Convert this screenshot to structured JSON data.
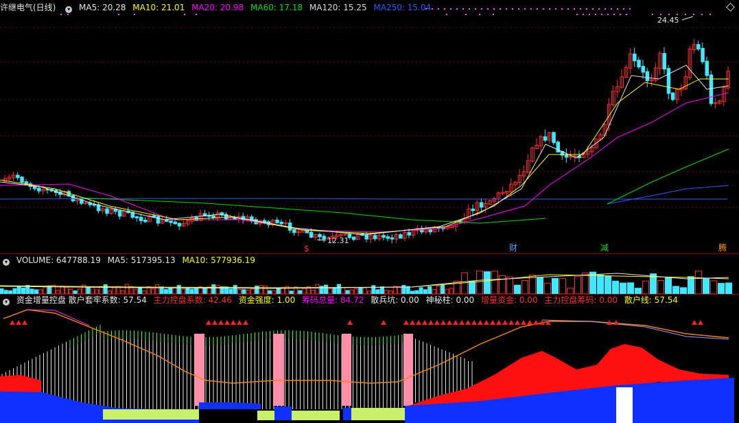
{
  "main": {
    "stock": "许继电气(日线)",
    "ma": [
      {
        "label": "MA5: 20.28",
        "color": "#e6e6e6"
      },
      {
        "label": "MA10: 21.01",
        "color": "#ffff00"
      },
      {
        "label": "MA20: 20.98",
        "color": "#ff00ff"
      },
      {
        "label": "MA60: 17.18",
        "color": "#00e000"
      },
      {
        "label": "MA120: 15.25",
        "color": "#dcdcdc"
      },
      {
        "label": "MA250: 15.04",
        "color": "#2a5cff"
      }
    ],
    "high_label": "24.45",
    "low_label": "12.31",
    "markers": [
      {
        "text": "$",
        "color": "#ff3030"
      },
      {
        "text": "财",
        "color": "#4aa8ff"
      },
      {
        "text": "减",
        "color": "#30d030"
      },
      {
        "text": "腾",
        "color": "#ff9900"
      }
    ],
    "diamond_icon": "diamond-icon"
  },
  "volume": {
    "items": [
      {
        "label": "VOLUME: 647788.19",
        "color": "#e6e6e6"
      },
      {
        "label": "MA5: 517395.13",
        "color": "#e6e6e6"
      },
      {
        "label": "MA10: 577936.19",
        "color": "#ffff00"
      }
    ]
  },
  "indicator": {
    "items": [
      {
        "label": "资金增量控盘  散户套牢系数: 57.54",
        "color": "#e6e6e6"
      },
      {
        "label": "主力控盘系数: 42.46",
        "color": "#ff3030"
      },
      {
        "label": "资金强度: 1.00",
        "color": "#ffff00"
      },
      {
        "label": "筹码总量: 84.72",
        "color": "#ff00ff"
      },
      {
        "label": "散兵坑: 0.00",
        "color": "#e6e6e6"
      },
      {
        "label": "神秘柱: 0.00",
        "color": "#e6e6e6"
      },
      {
        "label": "增量资金: 0.00",
        "color": "#ff3030"
      },
      {
        "label": "主力控盘筹码: 0.00",
        "color": "#ff3030"
      },
      {
        "label": "散户线: 57.54",
        "color": "#ffff00"
      }
    ]
  }
}
